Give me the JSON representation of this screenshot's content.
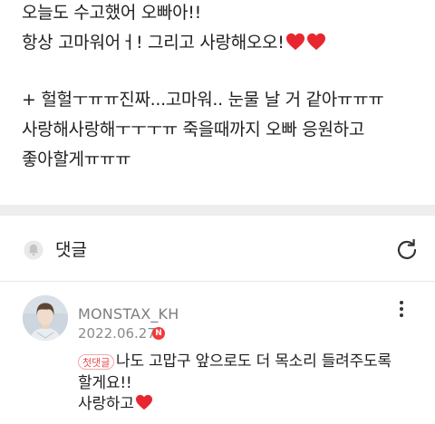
{
  "post": {
    "lines": [
      "오늘도 수고했어 오빠아!!",
      "항상 고마워어ㅓ! 그리고 사랑해오오!",
      "+ 헐헐ㅜㅠㅠ진짜...고마워.. 눈물 날 거 같아ㅠㅠㅠ",
      "사랑해사랑해ㅜㅜㅜㅠ 죽을때까지 오빠 응원하고",
      "좋아할게ㅠㅠㅠ"
    ]
  },
  "comments_section": {
    "title": "댓글",
    "icons": {
      "bell": "bell-icon",
      "refresh": "refresh-icon"
    }
  },
  "comment": {
    "username": "MONSTAX_KH",
    "date": "2022.06.27",
    "new_badge": "N",
    "first_badge": "첫댓글",
    "lines": [
      "나도 고맙구 앞으로도 더 목소리 들려주도록",
      "할게요!!",
      "사랑하고"
    ],
    "icons": {
      "more": "more-vertical-icon",
      "heart": "heart-icon"
    }
  },
  "colors": {
    "heart": "#e8262f",
    "badge_red": "#f23a3a",
    "section_gap": "#eeeeee",
    "muted_text": "#8a8a8a"
  }
}
